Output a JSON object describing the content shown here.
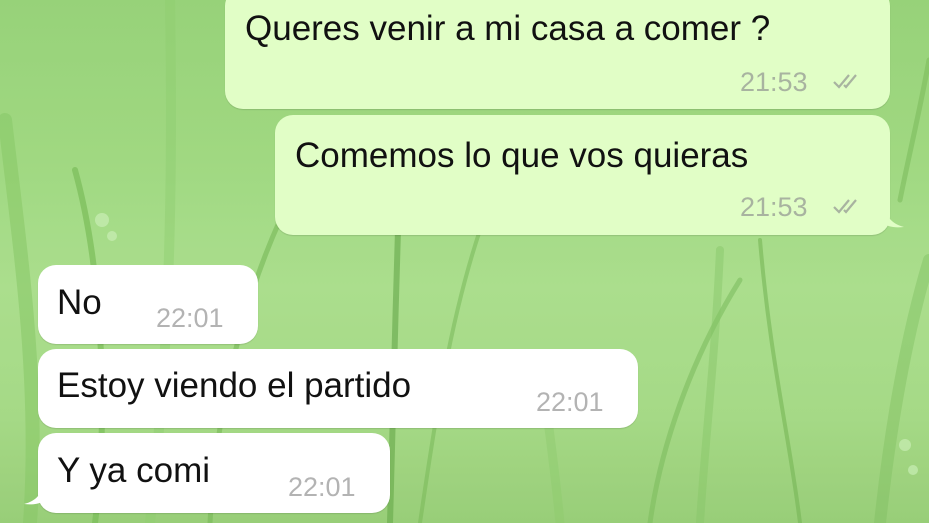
{
  "conversation": {
    "messages": [
      {
        "text": "Queres venir a mi casa a comer ?",
        "time": "21:53",
        "direction": "outgoing",
        "status_icon": "double-check-icon"
      },
      {
        "text": "Comemos lo que vos quieras",
        "time": "21:53",
        "direction": "outgoing",
        "status_icon": "double-check-icon"
      },
      {
        "text": "No",
        "time": "22:01",
        "direction": "incoming"
      },
      {
        "text": "Estoy viendo el partido",
        "time": "22:01",
        "direction": "incoming"
      },
      {
        "text": "Y ya comi",
        "time": "22:01",
        "direction": "incoming"
      }
    ]
  },
  "colors": {
    "outgoing_bubble": "#e1fec6",
    "incoming_bubble": "#ffffff",
    "background": "#98d577",
    "timestamp": "#a8b3a0"
  },
  "icons": {
    "read_receipt": "double-check-icon",
    "wallpaper": "grass-wallpaper"
  }
}
